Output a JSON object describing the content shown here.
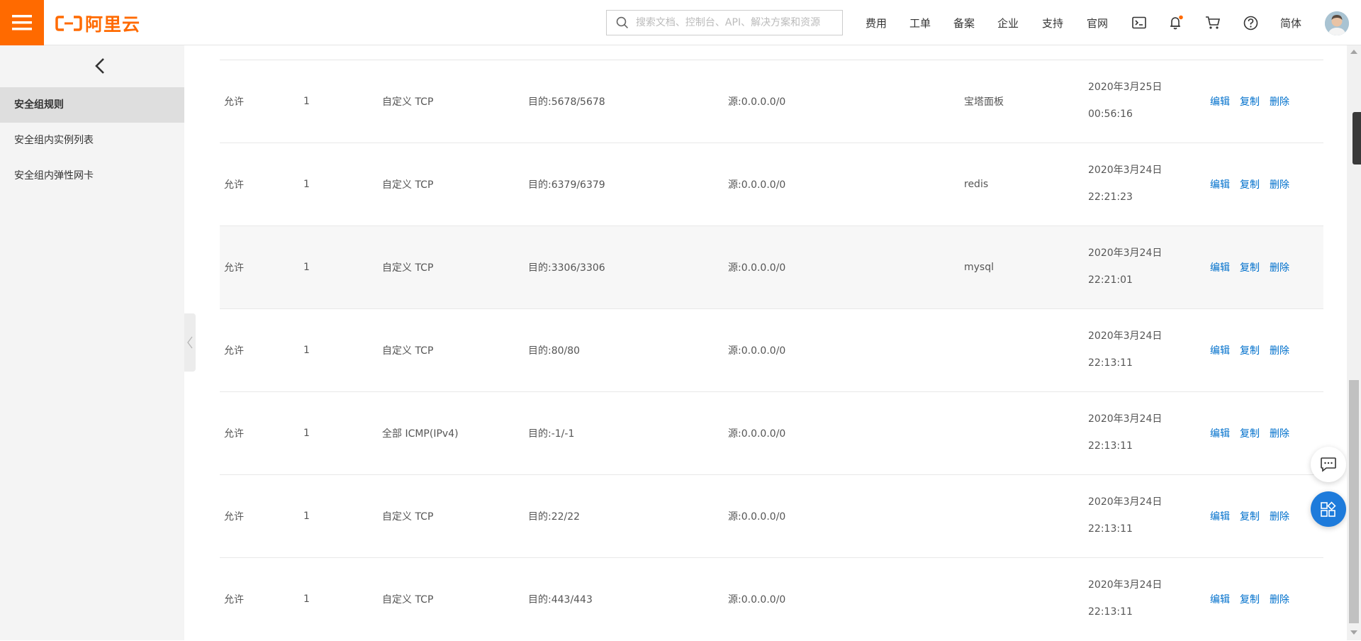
{
  "header": {
    "logo_text": "阿里云",
    "search_placeholder": "搜索文档、控制台、API、解决方案和资源",
    "nav": [
      "费用",
      "工单",
      "备案",
      "企业",
      "支持",
      "官网"
    ],
    "language": "简体",
    "accent_color": "#ff6a00",
    "icons": [
      "terminal-icon",
      "bell-icon",
      "cart-icon",
      "help-icon"
    ]
  },
  "sidebar": {
    "items": [
      "安全组规则",
      "安全组内实例列表",
      "安全组内弹性网卡"
    ],
    "active_index": 0
  },
  "table": {
    "rows": [
      {
        "policy": "允许",
        "priority": "1",
        "protocol": "自定义 TCP",
        "port": "目的:5678/5678",
        "source": "源:0.0.0.0/0",
        "description": "宝塔面板",
        "date": "2020年3月25日",
        "time": "00:56:16",
        "actions": [
          "编辑",
          "复制",
          "删除"
        ]
      },
      {
        "policy": "允许",
        "priority": "1",
        "protocol": "自定义 TCP",
        "port": "目的:6379/6379",
        "source": "源:0.0.0.0/0",
        "description": "redis",
        "date": "2020年3月24日",
        "time": "22:21:23",
        "actions": [
          "编辑",
          "复制",
          "删除"
        ]
      },
      {
        "policy": "允许",
        "priority": "1",
        "protocol": "自定义 TCP",
        "port": "目的:3306/3306",
        "source": "源:0.0.0.0/0",
        "description": "mysql",
        "date": "2020年3月24日",
        "time": "22:21:01",
        "actions": [
          "编辑",
          "复制",
          "删除"
        ]
      },
      {
        "policy": "允许",
        "priority": "1",
        "protocol": "自定义 TCP",
        "port": "目的:80/80",
        "source": "源:0.0.0.0/0",
        "description": "",
        "date": "2020年3月24日",
        "time": "22:13:11",
        "actions": [
          "编辑",
          "复制",
          "删除"
        ]
      },
      {
        "policy": "允许",
        "priority": "1",
        "protocol": "全部 ICMP(IPv4)",
        "port": "目的:-1/-1",
        "source": "源:0.0.0.0/0",
        "description": "",
        "date": "2020年3月24日",
        "time": "22:13:11",
        "actions": [
          "编辑",
          "复制",
          "删除"
        ]
      },
      {
        "policy": "允许",
        "priority": "1",
        "protocol": "自定义 TCP",
        "port": "目的:22/22",
        "source": "源:0.0.0.0/0",
        "description": "",
        "date": "2020年3月24日",
        "time": "22:13:11",
        "actions": [
          "编辑",
          "复制",
          "删除"
        ]
      },
      {
        "policy": "允许",
        "priority": "1",
        "protocol": "自定义 TCP",
        "port": "目的:443/443",
        "source": "源:0.0.0.0/0",
        "description": "",
        "date": "2020年3月24日",
        "time": "22:13:11",
        "actions": [
          "编辑",
          "复制",
          "删除"
        ]
      }
    ]
  }
}
